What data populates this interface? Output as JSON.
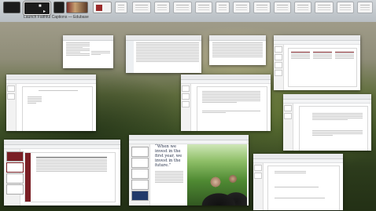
{
  "mission_control": {
    "space_title": "Launch Faithful Captions — Edubase",
    "accent": "#7a1f25"
  },
  "promo": {
    "quote": "“When we invest in the first year, we invest in the future.”"
  },
  "icons": {
    "lock": "lock-icon",
    "cursor": "cursor-icon"
  }
}
